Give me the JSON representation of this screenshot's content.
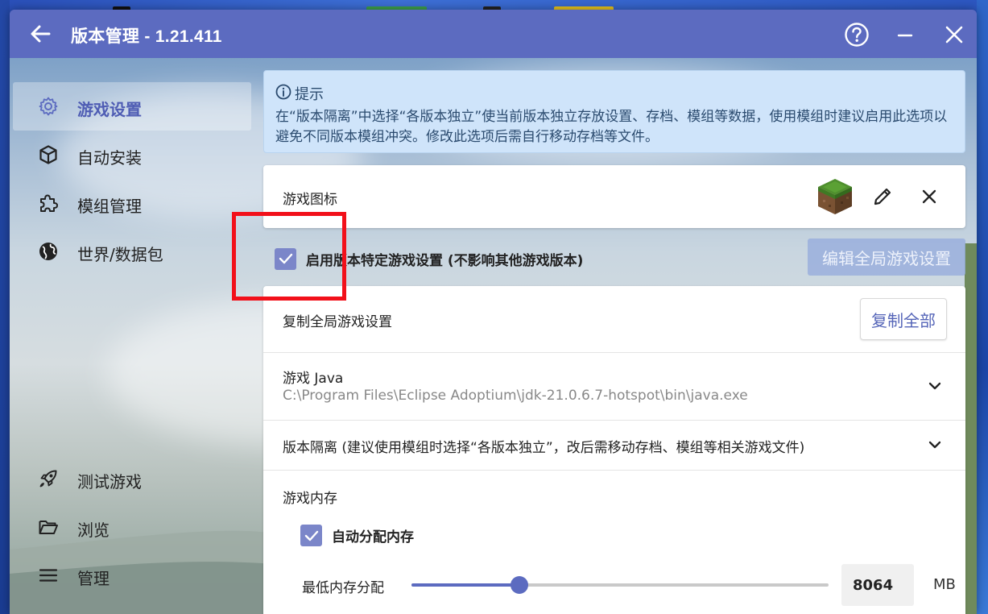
{
  "window": {
    "title": "版本管理 - 1.21.411"
  },
  "sidebar": {
    "items": [
      {
        "label": "游戏设置",
        "icon": "gear-icon",
        "active": true
      },
      {
        "label": "自动安装",
        "icon": "cube-icon",
        "active": false
      },
      {
        "label": "模组管理",
        "icon": "puzzle-icon",
        "active": false
      },
      {
        "label": "世界/数据包",
        "icon": "globe-icon",
        "active": false
      }
    ],
    "bottom_items": [
      {
        "label": "测试游戏",
        "icon": "rocket-icon"
      },
      {
        "label": "浏览",
        "icon": "folder-icon"
      },
      {
        "label": "管理",
        "icon": "menu-icon"
      }
    ]
  },
  "hint": {
    "title": "提示",
    "text": "在“版本隔离”中选择“各版本独立”使当前版本独立存放设置、存档、模组等数据，使用模组时建议启用此选项以避免不同版本模组冲突。修改此选项后需自行移动存档等文件。"
  },
  "game_icon": {
    "label": "游戏图标"
  },
  "specific_settings": {
    "label": "启用版本特定游戏设置 (不影响其他游戏版本)",
    "checked": true,
    "edit_global_label": "编辑全局游戏设置"
  },
  "settings": {
    "copy_global_label": "复制全局游戏设置",
    "copy_all_label": "复制全部",
    "java_label": "游戏 Java",
    "java_path": "C:\\Program Files\\Eclipse Adoptium\\jdk-21.0.6.7-hotspot\\bin\\java.exe",
    "isolation_label": "版本隔离 (建议使用模组时选择“各版本独立”，改后需移动存档、模组等相关游戏文件)",
    "memory_label": "游戏内存",
    "auto_memory_label": "自动分配内存",
    "auto_memory_checked": true,
    "min_memory_label": "最低内存分配",
    "min_memory_value": "8064",
    "min_memory_unit": "MB",
    "min_memory_slider_fraction": 0.258
  },
  "colors": {
    "accent": "#5c6bc0",
    "highlight": "#f2101a",
    "hint_bg": "#cfe4fa"
  }
}
